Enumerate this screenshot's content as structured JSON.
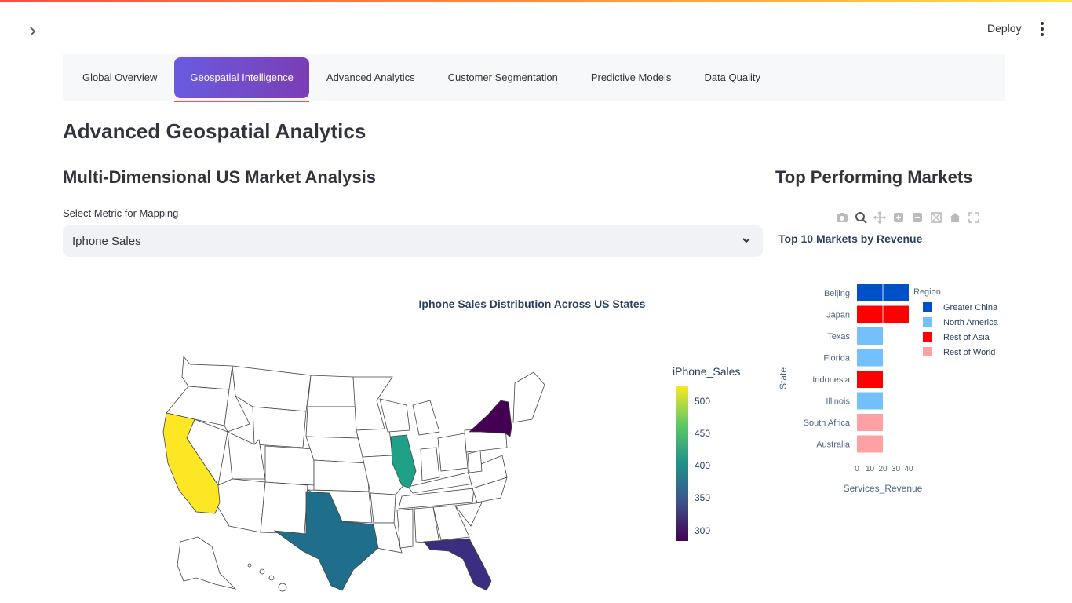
{
  "header": {
    "deploy_label": "Deploy"
  },
  "tabs": [
    {
      "label": "Global Overview"
    },
    {
      "label": "Geospatial Intelligence",
      "active": true
    },
    {
      "label": "Advanced Analytics"
    },
    {
      "label": "Customer Segmentation"
    },
    {
      "label": "Predictive Models"
    },
    {
      "label": "Data Quality"
    }
  ],
  "page": {
    "title": "Advanced Geospatial Analytics",
    "section_title": "Multi-Dimensional US Market Analysis",
    "right_title": "Top Performing Markets"
  },
  "metric_select": {
    "label": "Select Metric for Mapping",
    "value": "Iphone Sales"
  },
  "map": {
    "title": "Iphone Sales Distribution Across US States",
    "colorbar_title": "iPhone_Sales",
    "colorbar_ticks": [
      "500",
      "450",
      "400",
      "350",
      "300"
    ],
    "colorscale": [
      "#440154",
      "#3b528b",
      "#21918c",
      "#5ec962",
      "#fde725"
    ],
    "highlighted_states": [
      {
        "state": "California",
        "color": "#fde725"
      },
      {
        "state": "Illinois",
        "color": "#1fa187"
      },
      {
        "state": "Texas",
        "color": "#1f6e8c"
      },
      {
        "state": "Florida",
        "color": "#3b2d80"
      },
      {
        "state": "New York",
        "color": "#440154"
      }
    ]
  },
  "modebar_icons": [
    "camera-icon",
    "zoom-icon",
    "pan-icon",
    "zoom-in-icon",
    "zoom-out-icon",
    "autoscale-icon",
    "home-icon",
    "fullscreen-icon"
  ],
  "chart_data": {
    "type": "bar",
    "orientation": "horizontal",
    "title": "Top 10 Markets by Revenue",
    "xlabel": "Services_Revenue",
    "ylabel": "State",
    "xticks": [
      "0",
      "10",
      "20",
      "30",
      "40"
    ],
    "legend_title": "Region",
    "legend_position": "top-right",
    "series": [
      {
        "name": "Greater China",
        "color": "#0050c8"
      },
      {
        "name": "North America",
        "color": "#74c0fc"
      },
      {
        "name": "Rest of Asia",
        "color": "#ff0000"
      },
      {
        "name": "Rest of World",
        "color": "#ffa0a5"
      }
    ],
    "bars": [
      {
        "category": "Beijing",
        "value": 40,
        "region": "Greater China"
      },
      {
        "category": "Japan",
        "value": 40,
        "region": "Rest of Asia"
      },
      {
        "category": "Texas",
        "value": 20,
        "region": "North America"
      },
      {
        "category": "Florida",
        "value": 20,
        "region": "North America"
      },
      {
        "category": "Indonesia",
        "value": 20,
        "region": "Rest of Asia"
      },
      {
        "category": "Illinois",
        "value": 20,
        "region": "North America"
      },
      {
        "category": "South Africa",
        "value": 20,
        "region": "Rest of World"
      },
      {
        "category": "Australia",
        "value": 20,
        "region": "Rest of World"
      }
    ],
    "xlim": [
      0,
      40
    ]
  }
}
